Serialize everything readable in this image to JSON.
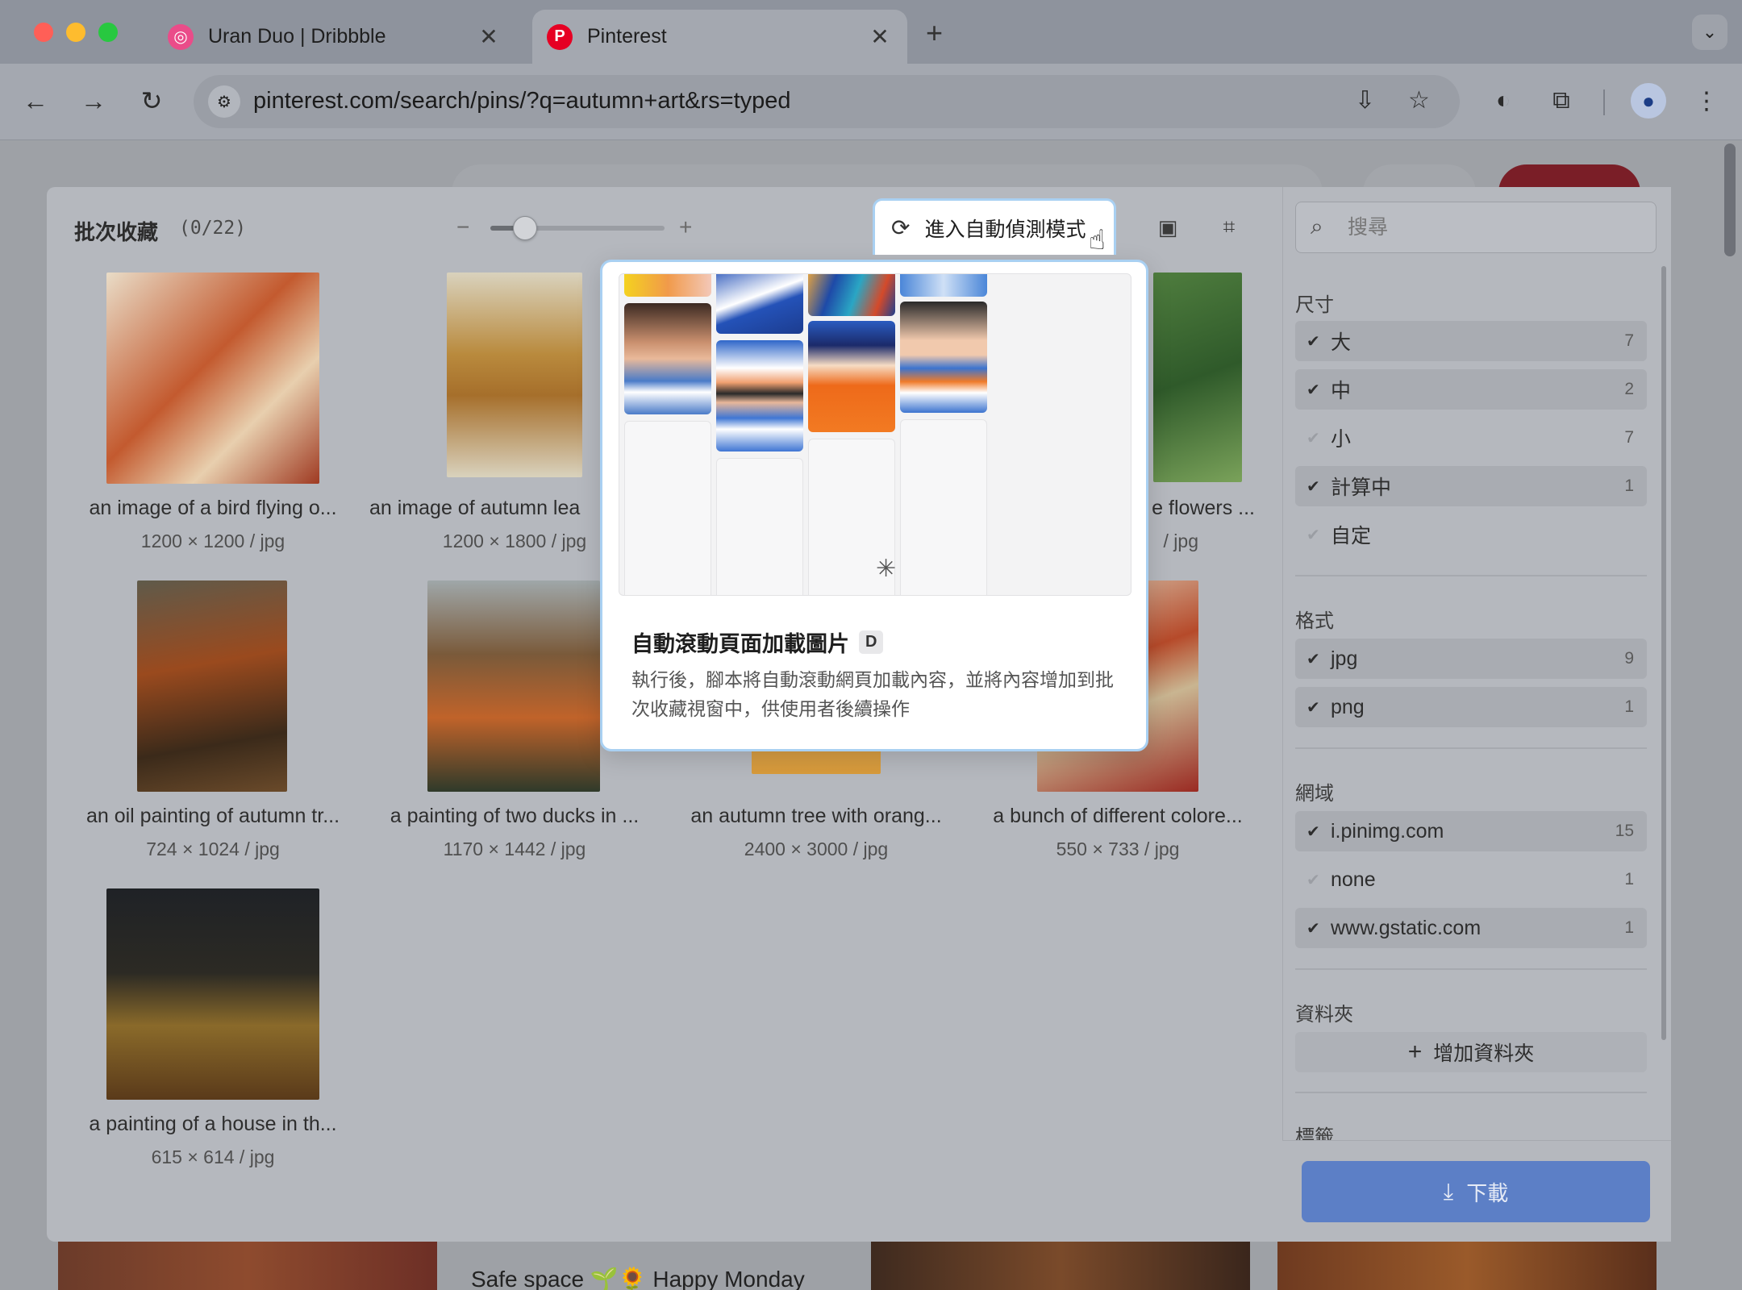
{
  "browser": {
    "tabs": [
      {
        "title": "Uran Duo | Dribbble",
        "favicon": "dribbble-icon",
        "active": false
      },
      {
        "title": "Pinterest",
        "favicon": "pinterest-icon",
        "active": true
      }
    ],
    "url": "pinterest.com/search/pins/?q=autumn+art&rs=typed",
    "close_glyph": "✕",
    "new_tab_glyph": "+"
  },
  "background_page": {
    "caption_fragment": "Safe space 🌱🌻 Happy Monday"
  },
  "batch_panel": {
    "title": "批次收藏",
    "count": "(0/22)",
    "zoom_value": 0.2,
    "auto_mode_button": "進入自動偵測模式",
    "cards": [
      {
        "caption": "an image of a bird flying o...",
        "meta": "1200 × 1200 / jpg"
      },
      {
        "caption": "an image of autumn lea",
        "meta": "1200 × 1800 / jpg"
      },
      {
        "caption": "e flowers ...",
        "meta": "/ jpg"
      },
      {
        "caption": "an oil painting of autumn tr...",
        "meta": "724 × 1024 / jpg"
      },
      {
        "caption": "a painting of two ducks in ...",
        "meta": "1170 × 1442 / jpg"
      },
      {
        "caption": "an autumn tree with orang...",
        "meta": "2400 × 3000 / jpg"
      },
      {
        "caption": "a bunch of different colore...",
        "meta": "550 × 733 / jpg"
      },
      {
        "caption": "a painting of a house in th...",
        "meta": "615 × 614 / jpg"
      }
    ]
  },
  "popover": {
    "title": "自動滾動頁面加載圖片",
    "shortcut": "D",
    "description": "執行後，腳本將自動滾動網頁加載內容，並將內容增加到批次收藏視窗中，供使用者後續操作"
  },
  "filters": {
    "search_placeholder": "搜尋",
    "size": {
      "title": "尺寸",
      "items": [
        {
          "label": "大",
          "count": "7",
          "checked": true
        },
        {
          "label": "中",
          "count": "2",
          "checked": true
        },
        {
          "label": "小",
          "count": "7",
          "checked": false
        },
        {
          "label": "計算中",
          "count": "1",
          "checked": true
        },
        {
          "label": "自定",
          "count": "",
          "checked": false
        }
      ]
    },
    "format": {
      "title": "格式",
      "items": [
        {
          "label": "jpg",
          "count": "9",
          "checked": true
        },
        {
          "label": "png",
          "count": "1",
          "checked": true
        }
      ]
    },
    "domain": {
      "title": "網域",
      "items": [
        {
          "label": "i.pinimg.com",
          "count": "15",
          "checked": true
        },
        {
          "label": "none",
          "count": "1",
          "checked": false
        },
        {
          "label": "www.gstatic.com",
          "count": "1",
          "checked": true
        }
      ]
    },
    "folder": {
      "title": "資料夾",
      "add_label": "增加資料夾"
    },
    "tags": {
      "title": "標籤"
    },
    "download_label": "下載",
    "check_glyph": "✔"
  },
  "colors": {
    "accent_blue": "#5c7fc6",
    "highlight_border": "#a9d0f2",
    "pinterest_red": "#e60023"
  }
}
